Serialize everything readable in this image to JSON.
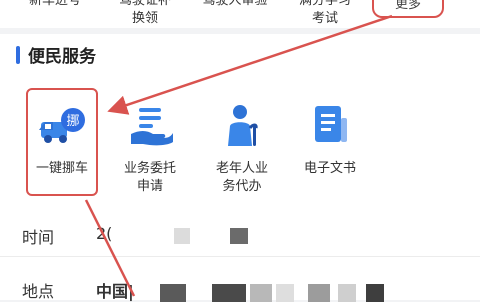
{
  "top_services": [
    {
      "line1": "新车进号",
      "line2": ""
    },
    {
      "line1": "驾驶证补",
      "line2": "换领"
    },
    {
      "line1": "驾驶人审验",
      "line2": ""
    },
    {
      "line1": "满分学习",
      "line2": "考试"
    }
  ],
  "more_label": "更多",
  "section_title": "便民服务",
  "services": [
    {
      "label": "一键挪车",
      "icon": "truck-move-icon"
    },
    {
      "label": "业务委托\n申请",
      "icon": "delegate-hand-icon"
    },
    {
      "label": "老年人业\n务代办",
      "icon": "elderly-person-icon"
    },
    {
      "label": "电子文书",
      "icon": "document-icon"
    }
  ],
  "move_badge": "挪",
  "info": {
    "time_label": "时间",
    "time_value": "2(",
    "place_label": "地点",
    "place_value": "中国|"
  },
  "colors": {
    "accent": "#2f6de0",
    "highlight": "#d9534f",
    "icon_blue": "#3a86e8"
  }
}
